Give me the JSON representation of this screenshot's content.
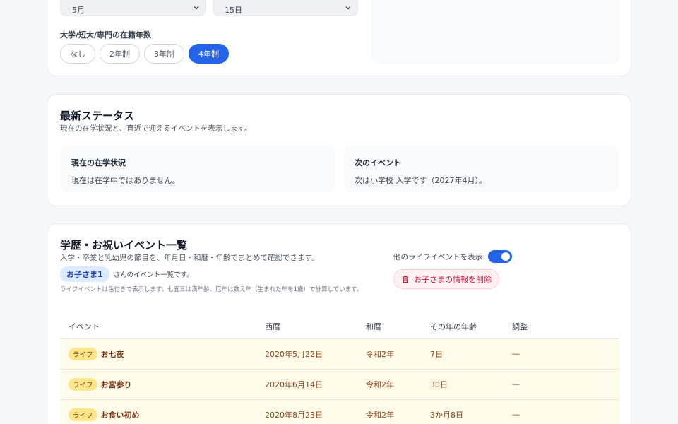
{
  "enrollment": {
    "month_value": "5月",
    "day_value": "15日",
    "years_label": "大学/短大/専門の在籍年数",
    "year_options": [
      "なし",
      "2年制",
      "3年制",
      "4年制"
    ],
    "selected_year_option": "4年制"
  },
  "status": {
    "title": "最新ステータス",
    "description": "現在の在学状況と、直近で迎えるイベントを表示します。",
    "current_label": "現在の在学状況",
    "current_value": "現在は在学中ではありません。",
    "next_label": "次のイベント",
    "next_value": "次は小学校 入学です（2027年4月）。"
  },
  "events": {
    "title": "学歴・お祝いイベント一覧",
    "description": "入学・卒業と乳幼児の節目を、年月日・和暦・年齢でまとめて確認できます。",
    "child_name": "お子さま1",
    "child_suffix": "さんのイベント一覧です。",
    "life_note": "ライフイベントは色付きで表示します。七五三は満年齢、厄年は数え年（生まれた年を1歳）で計算しています。",
    "toggle_label": "他のライフイベントを表示",
    "toggle_on": true,
    "delete_label": "お子さまの情報を削除",
    "columns": [
      "イベント",
      "西暦",
      "和暦",
      "その年の年齢",
      "調整"
    ],
    "rows": [
      {
        "tag": "ライフ",
        "name": "お七夜",
        "date": "2020年5月22日",
        "wareki": "令和2年",
        "age": "7日",
        "adjust": "—"
      },
      {
        "tag": "ライフ",
        "name": "お宮参り",
        "date": "2020年6月14日",
        "wareki": "令和2年",
        "age": "30日",
        "adjust": "—"
      },
      {
        "tag": "ライフ",
        "name": "お食い初め",
        "date": "2020年8月23日",
        "wareki": "令和2年",
        "age": "3か月8日",
        "adjust": "—"
      }
    ]
  },
  "colors": {
    "accent": "#2563eb",
    "life_row_bg": "#fffbeb",
    "delete_text": "#be123c"
  }
}
